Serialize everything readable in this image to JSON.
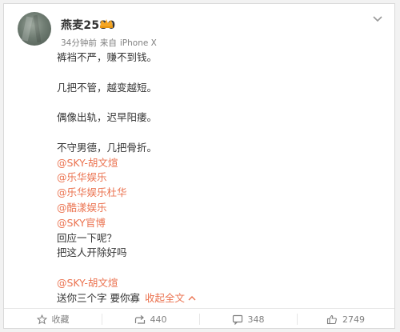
{
  "post": {
    "author": "燕麦2580",
    "time": "34分钟前",
    "source_prefix": "来自",
    "source": "iPhone X"
  },
  "content": {
    "lines": [
      "裤裆不严，赚不到钱。",
      "",
      "几把不管，越变越短。",
      "",
      "偶像出轨，迟早阳痿。",
      "",
      "不守男德，几把骨折。"
    ],
    "mentions": [
      "@SKY-胡文煊",
      "@乐华娱乐",
      "@乐华娱乐杜华",
      "@酷漾娱乐",
      "@SKY官博"
    ],
    "after_mentions": [
      "回应一下呢？",
      "把这人开除好吗"
    ],
    "final_mention": "@SKY-胡文煊",
    "final_text": "送你三个字 要你寡",
    "collapse_label": "收起全文"
  },
  "actions": {
    "favorite_label": "收藏",
    "repost_count": "440",
    "comment_count": "348",
    "like_count": "2749"
  },
  "colors": {
    "accent": "#eb7350",
    "text": "#333333",
    "muted": "#808080",
    "vip": "#f5a623"
  },
  "icons": {
    "vip": "vip-crown-icon",
    "chevron": "chevron-down-icon",
    "favorite": "star-outline-icon",
    "repost": "share-icon",
    "comment": "comment-icon",
    "like": "thumbs-up-icon"
  }
}
